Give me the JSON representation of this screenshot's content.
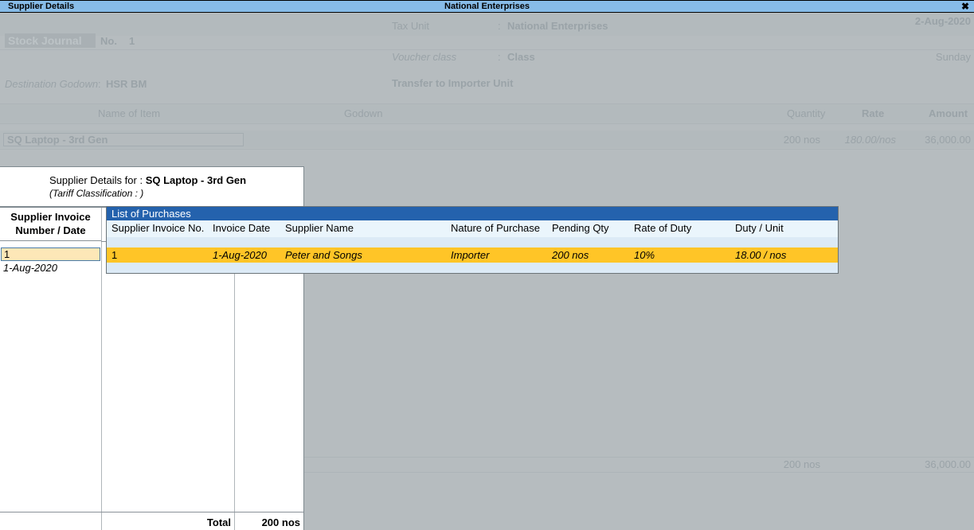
{
  "titlebar": {
    "left_title": "Supplier Details",
    "center_title": "National Enterprises",
    "close_icon": "close-icon",
    "close_glyph": "✖"
  },
  "voucher": {
    "type": "Stock Journal",
    "no_label": "No.",
    "no_value": "1",
    "tax_unit_label": "Tax Unit",
    "tax_unit_sep": ":",
    "tax_unit_value": "National Enterprises",
    "date": "2-Aug-2020",
    "day": "Sunday",
    "voucher_class_label": "Voucher class",
    "voucher_class_sep": ":",
    "voucher_class_value": "Class",
    "destination_godown_label": "Destination Godown",
    "destination_godown_sep": ":",
    "destination_godown_value": "HSR BM",
    "transfer_label": "Transfer to Importer Unit",
    "col_name_of_item": "Name of Item",
    "col_godown": "Godown",
    "col_quantity": "Quantity",
    "col_rate": "Rate",
    "col_amount": "Amount",
    "item_name": "SQ Laptop - 3rd Gen",
    "item_quantity": "200 nos",
    "item_rate": "180.00/nos",
    "item_amount": "36,000.00",
    "total_quantity": "200 nos",
    "total_amount": "36,000.00"
  },
  "detail_card": {
    "label": "Supplier Details for",
    "separator": ":",
    "item": "SQ Laptop - 3rd Gen",
    "tariff": "(Tariff Classification : )"
  },
  "left_panel": {
    "header_line1": "Supplier Invoice",
    "header_line2": "Number / Date",
    "invoice_number": "1",
    "invoice_date": "1-Aug-2020",
    "total_label": "Total",
    "total_value": "200 nos"
  },
  "list_of_purchases": {
    "title": "List of Purchases",
    "columns": [
      "Supplier Invoice No.",
      "Invoice Date",
      "Supplier Name",
      "Nature of Purchase",
      "Pending Qty",
      "Rate of Duty",
      "Duty / Unit"
    ],
    "rows": [
      {
        "invoice_no": "1",
        "invoice_date": "1-Aug-2020",
        "supplier_name": "Peter and Songs",
        "nature_of_purchase": "Importer",
        "pending_qty": "200 nos",
        "rate_of_duty": "10%",
        "duty_per_unit": "18.00 / nos"
      }
    ]
  },
  "colors": {
    "titlebar": "#87bce8",
    "panel_header_blue": "#2462ad",
    "selected_row": "#ffc527",
    "panel_bg": "#dceaf6",
    "input_highlight": "#fde7b7",
    "app_bg": "#b6bcbf"
  }
}
